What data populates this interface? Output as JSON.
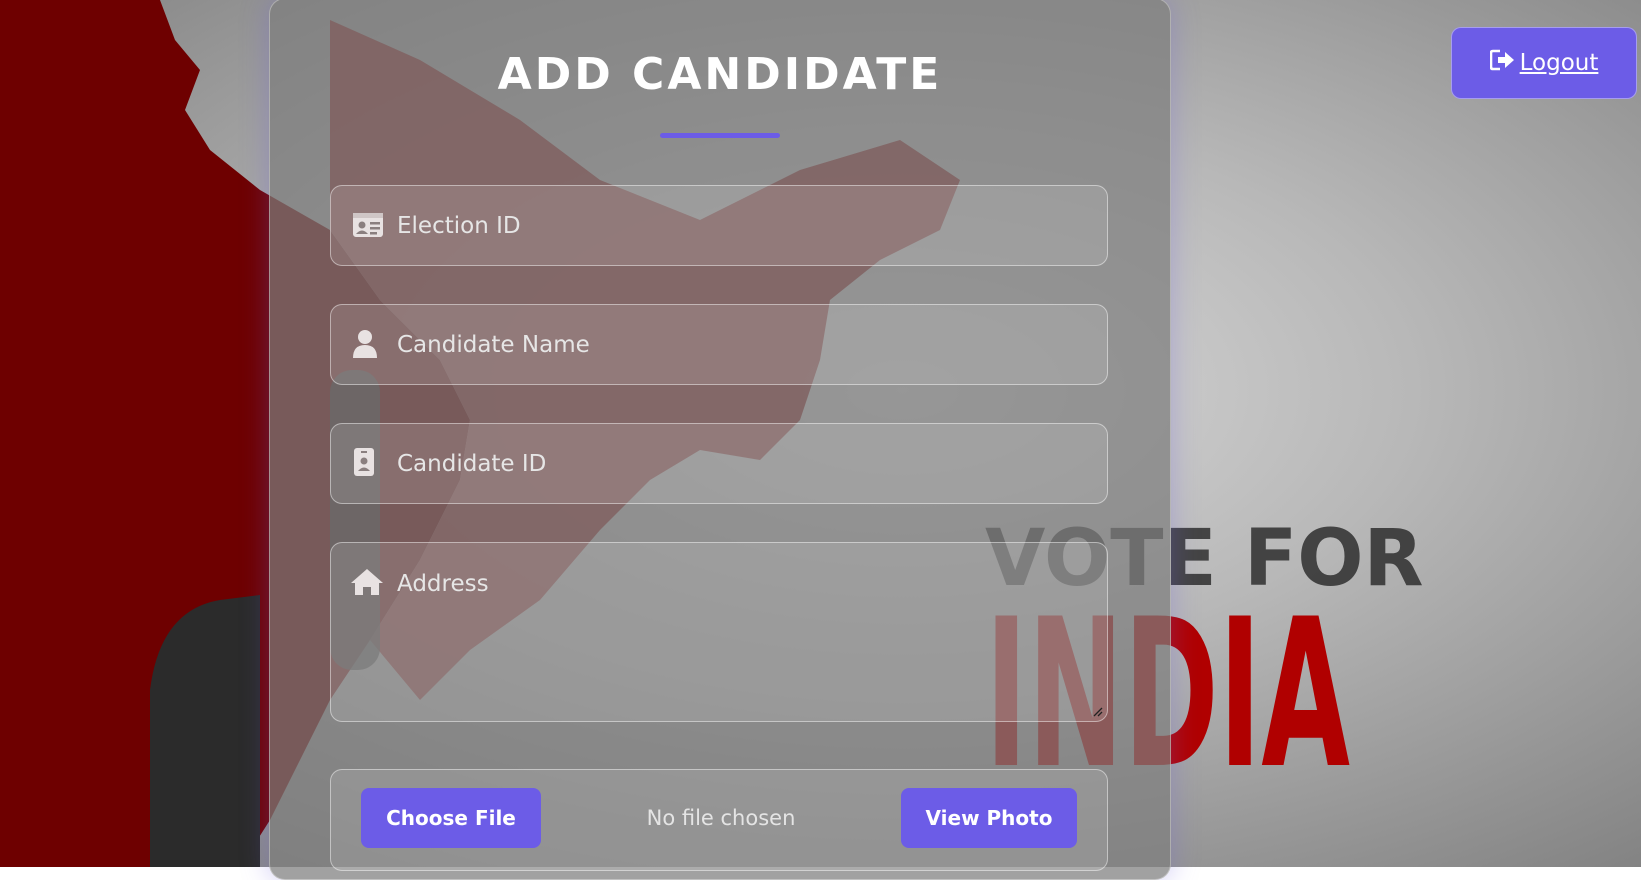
{
  "background": {
    "poster_text_line1": "VOTE FOR",
    "poster_text_line2": "INDIA"
  },
  "form": {
    "title": "ADD CANDIDATE",
    "fields": [
      {
        "placeholder": "Election ID",
        "icon": "id-card-icon",
        "value": ""
      },
      {
        "placeholder": "Candidate Name",
        "icon": "user-icon",
        "value": ""
      },
      {
        "placeholder": "Candidate ID",
        "icon": "id-badge-icon",
        "value": ""
      },
      {
        "placeholder": "Address",
        "icon": "home-icon",
        "value": ""
      }
    ],
    "file": {
      "choose_label": "Choose File",
      "status": "No file chosen",
      "view_label": "View Photo"
    }
  },
  "header": {
    "logout_label": "Logout",
    "logout_icon": "sign-out-icon"
  },
  "colors": {
    "accent": "#6c5ce7",
    "poster_red": "#b00000"
  }
}
